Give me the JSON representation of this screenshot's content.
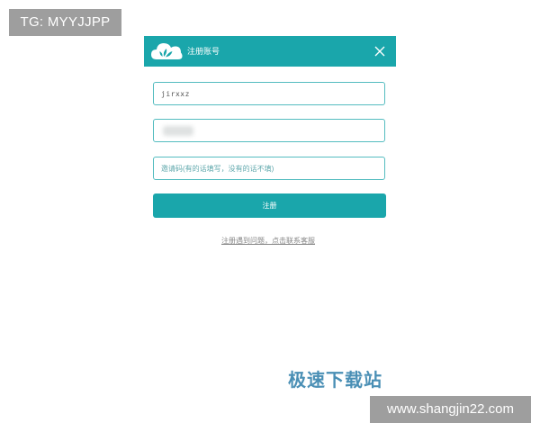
{
  "watermark": {
    "tg_text": "TG: MYYJJPP",
    "site_name": "极速下载站",
    "site_url": "www.shangjin22.com"
  },
  "dialog": {
    "title": "注册账号",
    "username_value": "jirxxz",
    "invite_placeholder": "邀请码(有的话填写，没有的话不填)",
    "register_label": "注册",
    "help_link": "注册遇到问题，点击联系客服"
  },
  "colors": {
    "accent": "#1aa6ab",
    "field_border": "#54bcc0",
    "watermark_bg": "#9e9e9e",
    "site_name": "#4a8fb5"
  }
}
